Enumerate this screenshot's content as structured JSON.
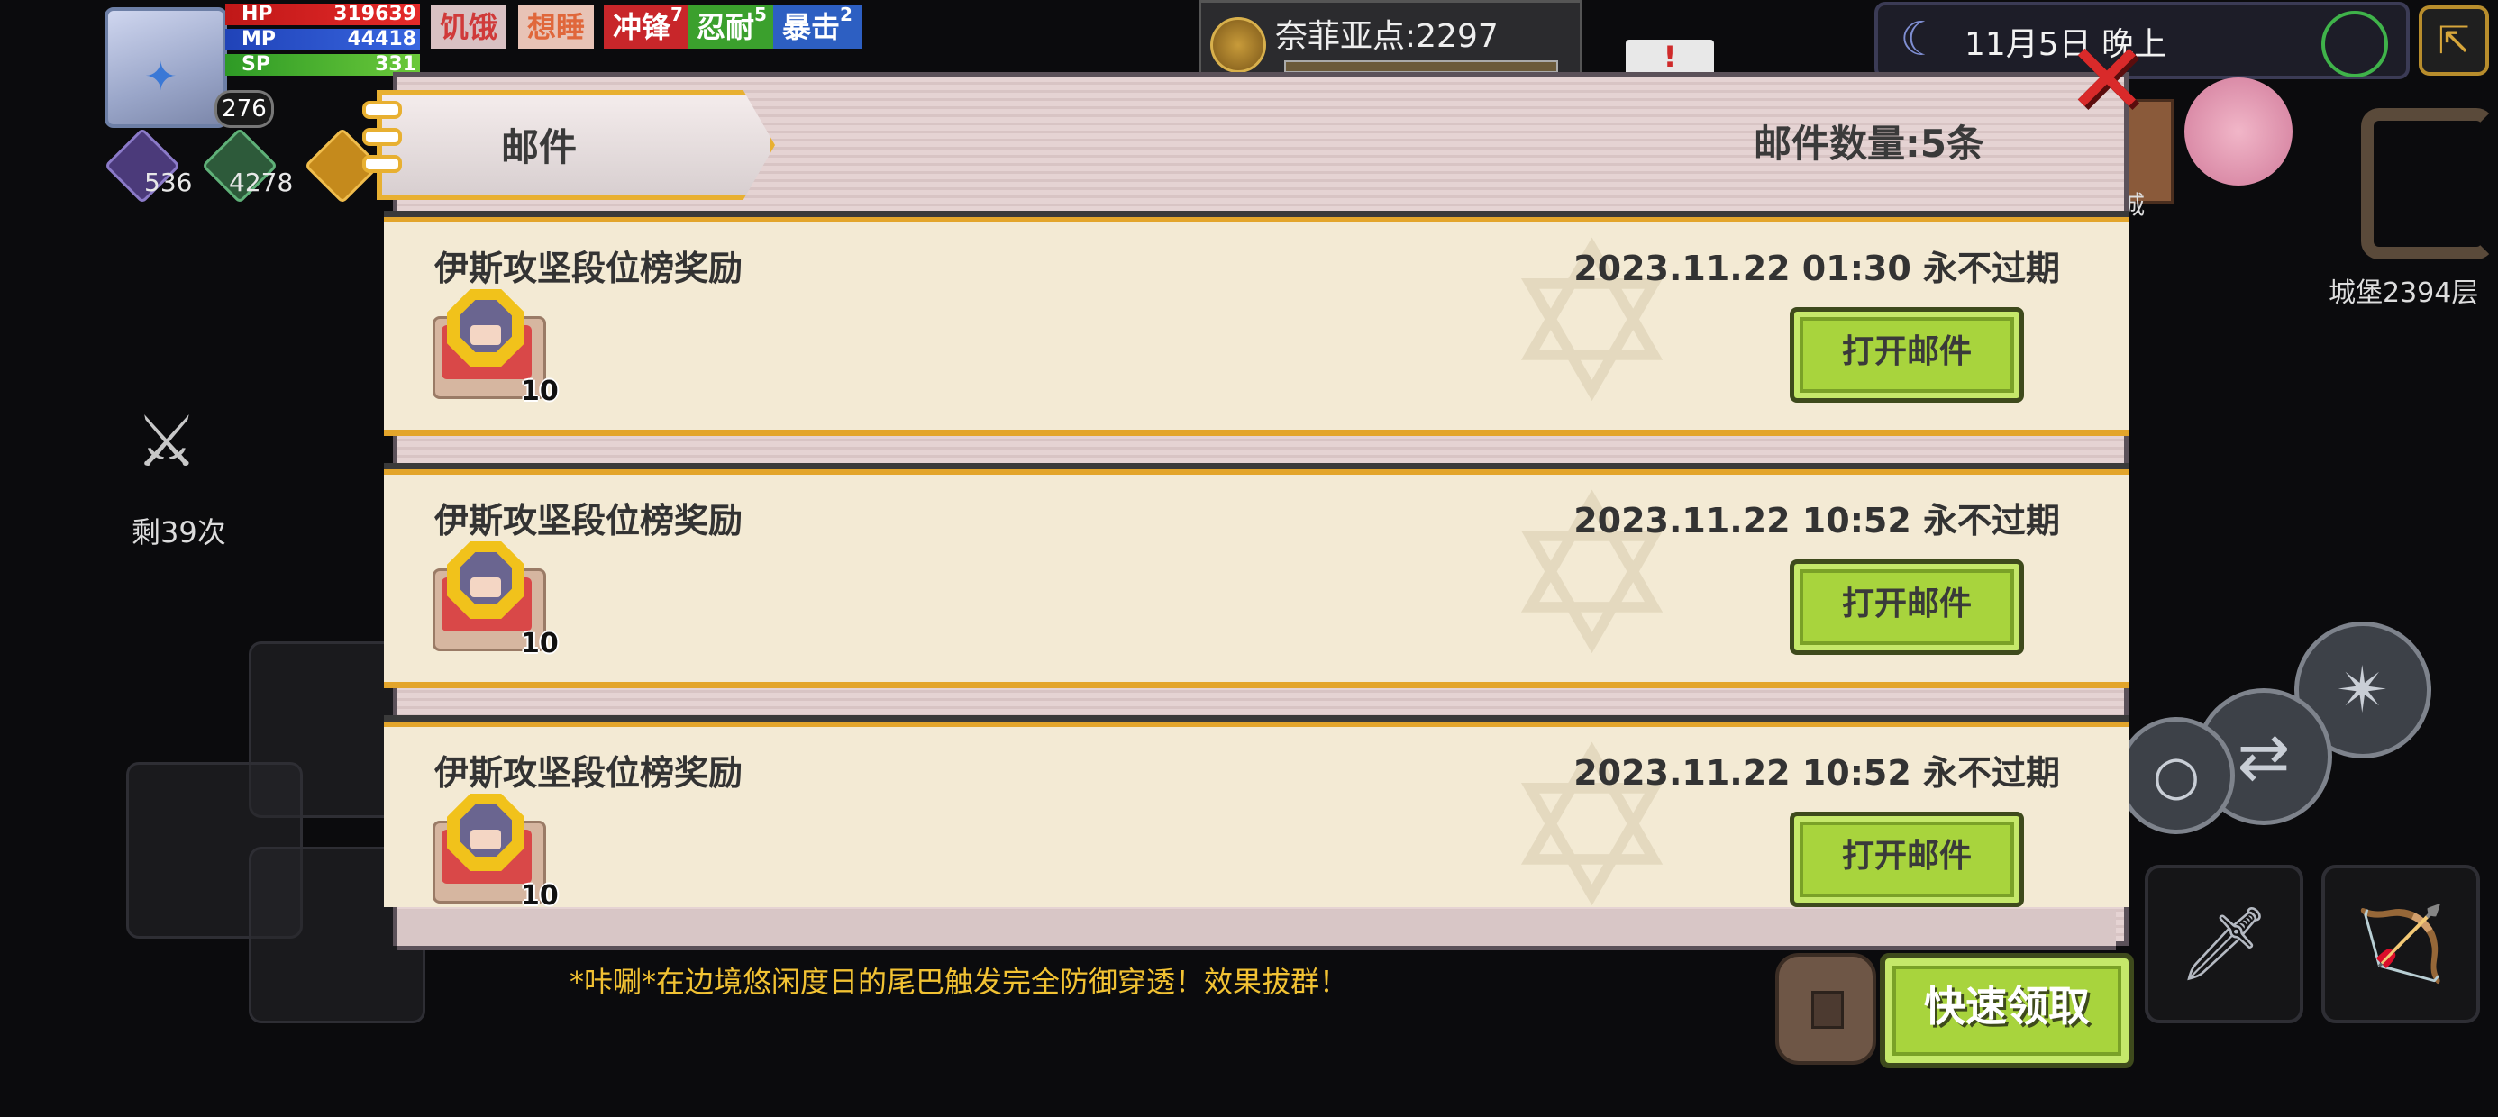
{
  "hud": {
    "level": "276",
    "hp_label": "HP",
    "hp_value": "319639",
    "mp_label": "MP",
    "mp_value": "44418",
    "sp_label": "SP",
    "sp_value": "331",
    "statuses": [
      {
        "label": "饥饿",
        "sup": ""
      },
      {
        "label": "想睡",
        "sup": ""
      },
      {
        "label": "冲锋",
        "sup": "7"
      },
      {
        "label": "忍耐",
        "sup": "5"
      },
      {
        "label": "暴击",
        "sup": "2"
      }
    ],
    "resources": [
      {
        "icon": "purple-crystal-icon",
        "value": "536"
      },
      {
        "icon": "green-orb-icon",
        "value": "4278"
      }
    ],
    "points": "奈菲亚点:2297",
    "date": "11月5日 晚上",
    "remaining_attempts": "剩39次",
    "castle_floor": "城堡2394层",
    "city_tag": "城",
    "alert": "!"
  },
  "mail_panel": {
    "title": "邮件",
    "count_label": "邮件数量:5条",
    "mails": [
      {
        "title": "伊斯攻坚段位榜奖励",
        "timestamp": "2023.11.22 01:30  永不过期",
        "item_qty": "10",
        "open_label": "打开邮件"
      },
      {
        "title": "伊斯攻坚段位榜奖励",
        "timestamp": "2023.11.22 10:52  永不过期",
        "item_qty": "10",
        "open_label": "打开邮件"
      },
      {
        "title": "伊斯攻坚段位榜奖励",
        "timestamp": "2023.11.22 10:52  永不过期",
        "item_qty": "10",
        "open_label": "打开邮件"
      }
    ]
  },
  "quick_claim_label": "快速领取",
  "combat_message": "*咔唰*在边境悠闲度日的尾巴触发完全防御穿透！效果拔群！"
}
